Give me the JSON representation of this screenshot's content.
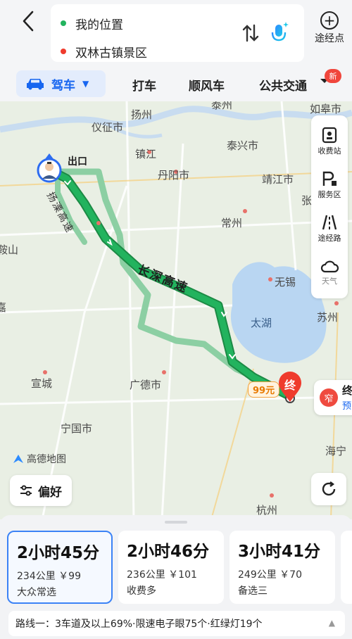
{
  "header": {
    "origin": "我的位置",
    "destination": "双林古镇景区",
    "waypoint_label": "途经点",
    "colors": {
      "origin_dot": "#22b35e",
      "destination_dot": "#ef3b2d"
    }
  },
  "tabs": {
    "drive": "驾车",
    "taxi": "打车",
    "carpool": "顺风车",
    "transit": "公共交通",
    "new_badge": "新"
  },
  "map": {
    "labels": {
      "yangzhou": "扬州",
      "yizheng": "仪征市",
      "zhenjiang": "镇江",
      "danyang": "丹阳市",
      "taixing": "泰兴市",
      "jingjiang": "靖江市",
      "changzhou": "常州",
      "wuxi": "无锡",
      "suzhou": "苏州",
      "taihu": "太湖",
      "xuancheng": "宣城",
      "guangde": "广德市",
      "ningguo": "宁国市",
      "hangzhou": "杭州",
      "haining": "海宁",
      "rugao": "如皋市",
      "zhang": "张",
      "anshan": "鞍山",
      "jia": "嘉",
      "tai_top": "泰州"
    },
    "route_names": {
      "main": "长深高速",
      "alt": "扬溧高速"
    },
    "exit_label": "出口",
    "end_marker": "终",
    "toll_tag": "99元",
    "dest_card": {
      "badge": "窄",
      "title": "终",
      "subtitle": "预"
    },
    "logo": "高德地图",
    "side_panel": [
      {
        "label": "收费站",
        "icon": "toll-icon"
      },
      {
        "label": "服务区",
        "icon": "service-area-icon"
      },
      {
        "label": "途经路",
        "icon": "road-icon"
      },
      {
        "label": "天气",
        "icon": "cloud-icon"
      }
    ],
    "preference": "偏好",
    "colors": {
      "route_main": "#1fa85a",
      "route_alt": "#8ccfa3",
      "lake": "#b9d6f2",
      "land": "#e9efe4"
    }
  },
  "routes": [
    {
      "time": "2小时45分",
      "distance": "234公里 ￥99",
      "tag": "大众常选",
      "selected": true
    },
    {
      "time": "2小时46分",
      "distance": "236公里 ￥101",
      "tag": "收费多",
      "selected": false
    },
    {
      "time": "3小时41分",
      "distance": "249公里 ￥70",
      "tag": "备选三",
      "selected": false
    }
  ],
  "info_bar": "路线一：3车道及以上69%·限速电子眼75个·红绿灯19个"
}
